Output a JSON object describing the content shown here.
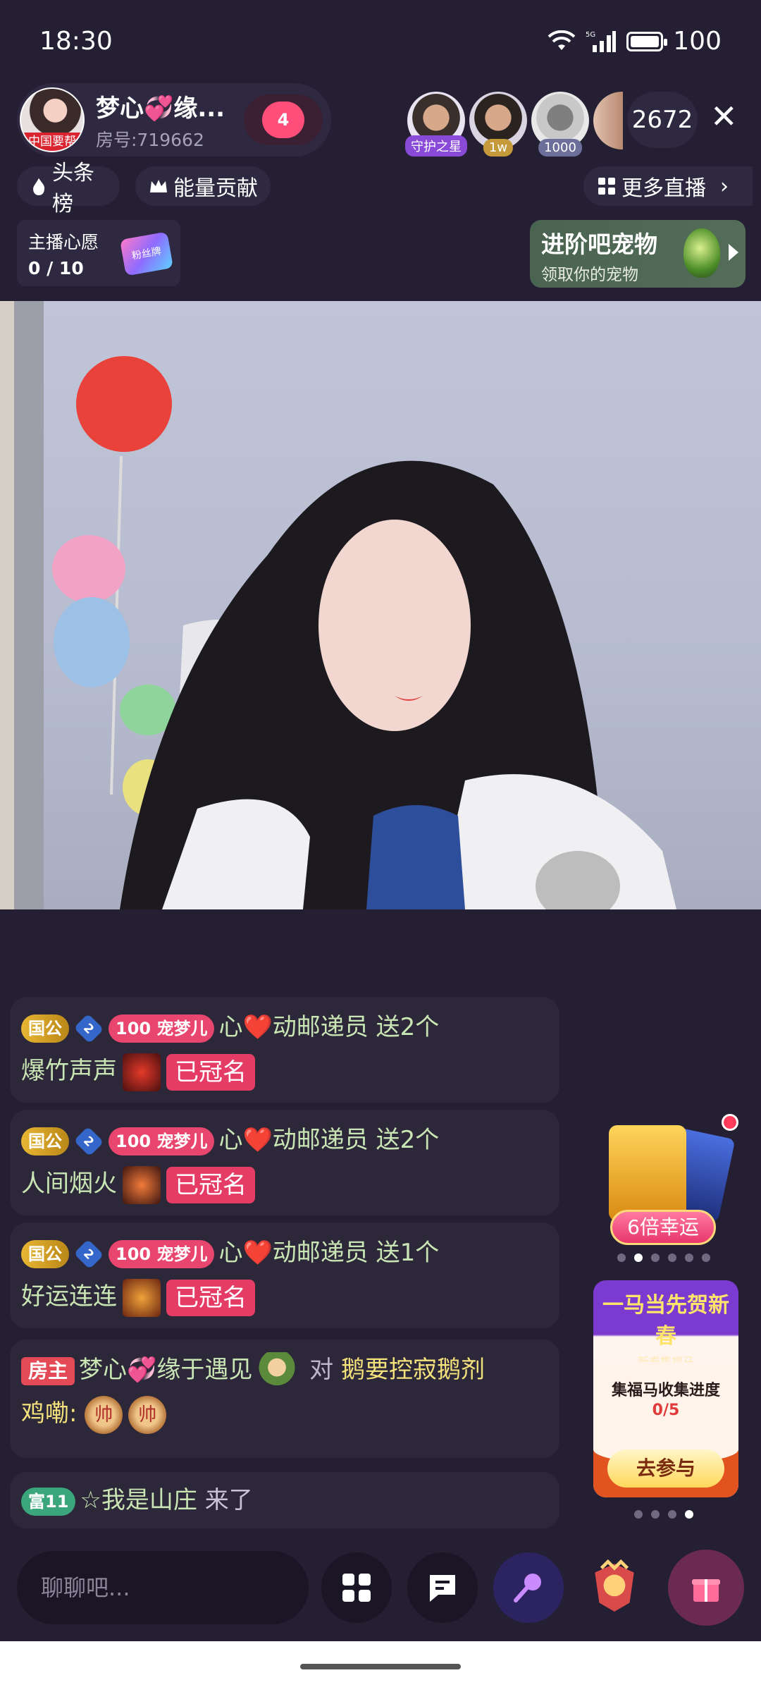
{
  "status_bar": {
    "time": "18:30",
    "battery": "100",
    "battery_level": 1.0,
    "network": "5G"
  },
  "host": {
    "name": "梦心💞缘...",
    "room": "房号:719662",
    "avatar_tag": "中国要帮",
    "follow_count": "4"
  },
  "viewers": [
    {
      "badge": "守护之星",
      "badge_color": "#8a4ad8"
    },
    {
      "badge": "1w",
      "badge_color": "#c49a3a"
    },
    {
      "badge": "1000",
      "badge_color": "#6b6f9a"
    },
    {
      "badge": "",
      "badge_color": ""
    }
  ],
  "viewer_count": "2672",
  "pills": {
    "headline": "头条榜",
    "energy": "能量贡献",
    "more_live": "更多直播"
  },
  "wish": {
    "title": "主播心愿",
    "value": "0 / 10",
    "badge": "粉丝牌"
  },
  "pet": {
    "title": "进阶吧宠物",
    "subtitle": "领取你的宠物"
  },
  "chat": [
    {
      "badge_guogong": "国公",
      "level": "2",
      "fan_level": "100",
      "fan_name": "宠梦儿",
      "user": "心❤️动邮递员",
      "action": " 送2个",
      "gift": "爆竹声声",
      "crown": "已冠名"
    },
    {
      "badge_guogong": "国公",
      "level": "2",
      "fan_level": "100",
      "fan_name": "宠梦儿",
      "user": "心❤️动邮递员",
      "action": " 送2个",
      "gift": "人间烟火",
      "crown": "已冠名"
    },
    {
      "badge_guogong": "国公",
      "level": "2",
      "fan_level": "100",
      "fan_name": "宠梦儿",
      "user": "心❤️动邮递员",
      "action": " 送1个",
      "gift": "好运连连",
      "crown": "已冠名"
    }
  ],
  "owner_msg": {
    "badge": "房主",
    "user": "梦心💞缘于遇见",
    "verb": " 对 ",
    "target": "鹅要控寂鹅剂",
    "line2": "鸡嘞:",
    "coin1": "帅",
    "coin2": "帅"
  },
  "join_msg": {
    "badge": "富11",
    "user": "☆我是山庄",
    "action": " 来了"
  },
  "lucky": {
    "label": "6倍幸运"
  },
  "event": {
    "title": "一马当先贺新春",
    "subtitle": "新春集福马",
    "label": "集福马收集进度",
    "progress": "0/5",
    "button": "去参与"
  },
  "input": {
    "placeholder": "聊聊吧..."
  }
}
